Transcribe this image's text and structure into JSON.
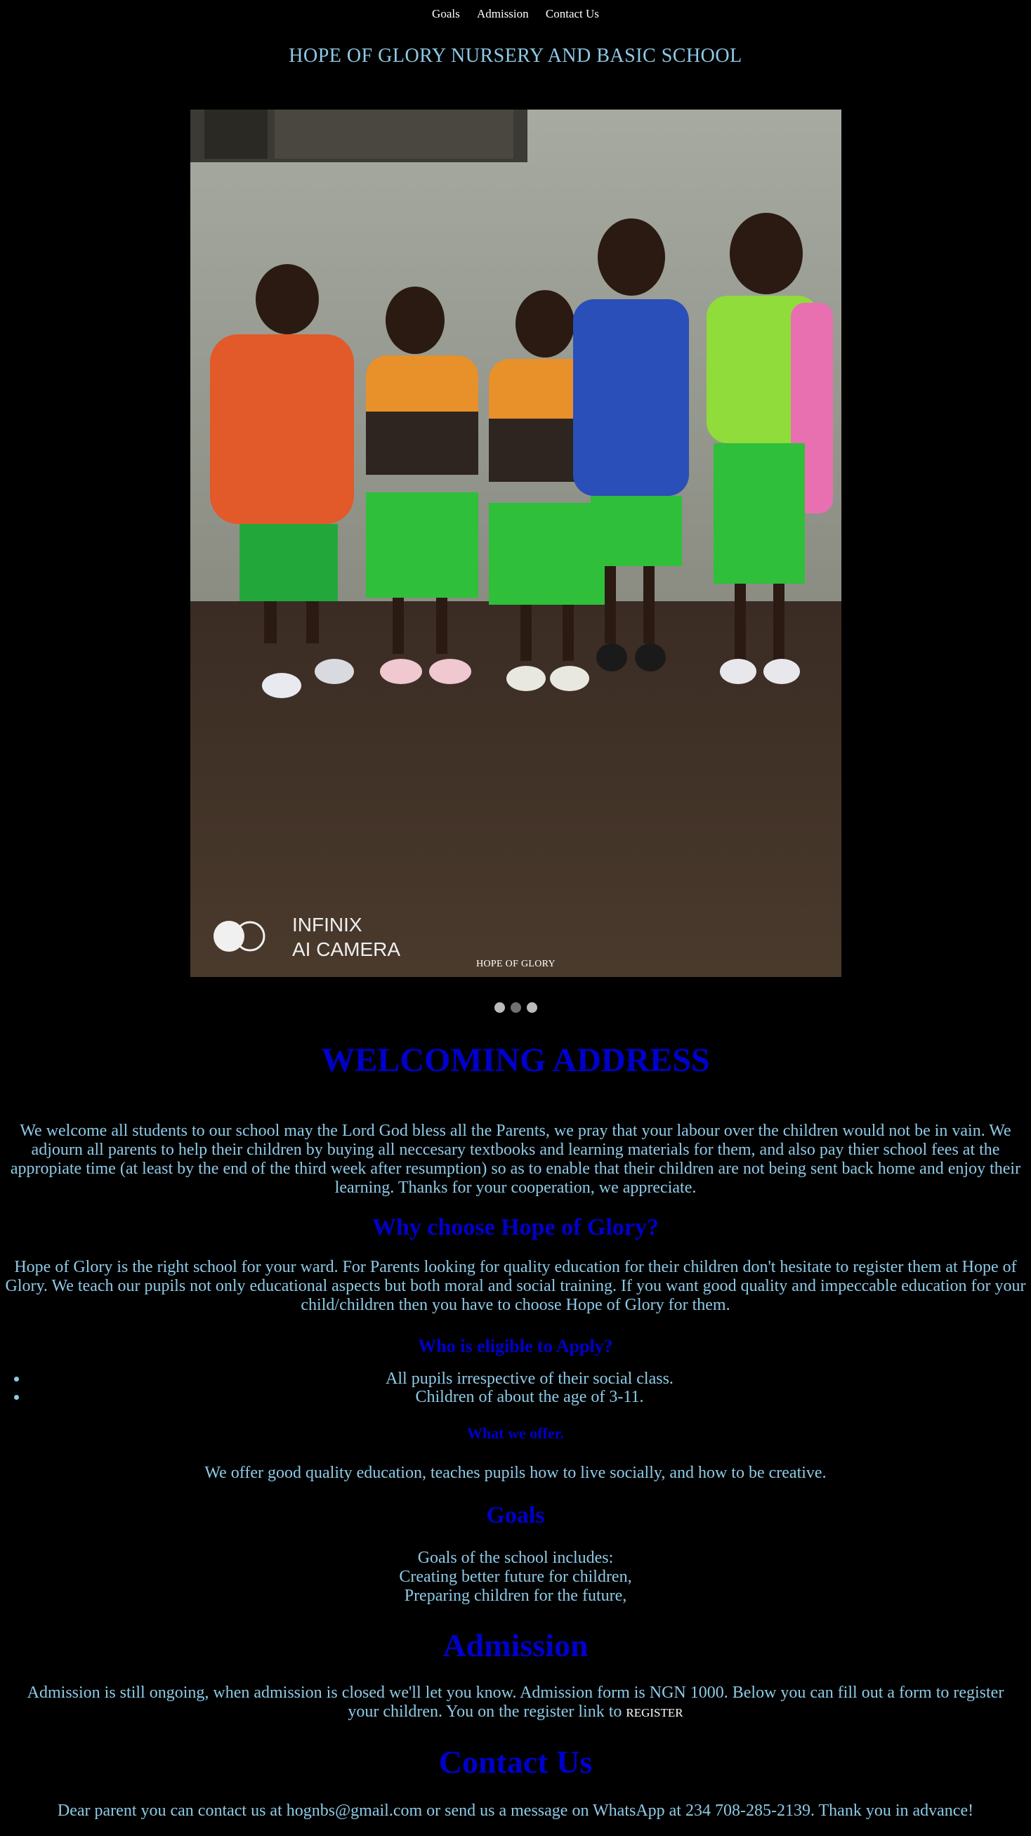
{
  "nav": {
    "items": [
      "Goals",
      "Admission",
      "Contact Us"
    ]
  },
  "site_title": "HOPE OF GLORY NURSERY AND BASIC SCHOOL",
  "carousel": {
    "caption": "HOPE OF GLORY",
    "watermark_line1": "INFINIX",
    "watermark_line2": "AI CAMERA",
    "dot_count": 3,
    "active_dot": 1
  },
  "welcome": {
    "heading": "WELCOMING ADDRESS",
    "body": "We welcome all students to our school may the Lord God bless all the Parents, we pray that your labour over the children would not be in vain. We adjourn all parents to help their children by buying all neccesary textbooks and learning materials for them, and also pay thier school fees at the appropiate time (at least by the end of the third week after resumption) so as to enable that their children are not being sent back home and enjoy their learning. Thanks for your cooperation, we appreciate."
  },
  "why": {
    "heading": "Why choose Hope of Glory?",
    "body": "Hope of Glory is the right school for your ward. For Parents looking for quality education for their children don't hesitate to register them at Hope of Glory. We teach our pupils not only educational aspects but both moral and social training. If you want good quality and impeccable education for your child/children then you have to choose Hope of Glory for them."
  },
  "eligible": {
    "heading": "Who is eligible to Apply?",
    "items": [
      "All pupils irrespective of their social class.",
      "Children of about the age of 3-11."
    ]
  },
  "offer": {
    "heading": "What we offer.",
    "body": "We offer good quality education, teaches pupils how to live socially, and how to be creative."
  },
  "goals": {
    "heading": "Goals",
    "lines": [
      "Goals of the school includes:",
      "Creating better future for children,",
      "Preparing children for the future,"
    ]
  },
  "admission": {
    "heading": "Admission",
    "body": "Admission is still ongoing, when admission is closed we'll let you know. Admission form is NGN 1000. Below you can fill out a form to register your children. You on the register link to",
    "register_label": "REGISTER"
  },
  "contact": {
    "heading": "Contact Us",
    "body": "Dear parent you can contact us at hognbs@gmail.com or send us a message on WhatsApp at 234 708-285-2139. Thank you in advance!"
  },
  "colors": {
    "background": "#000000",
    "heading": "#0000cd",
    "text": "#8ecae6"
  }
}
